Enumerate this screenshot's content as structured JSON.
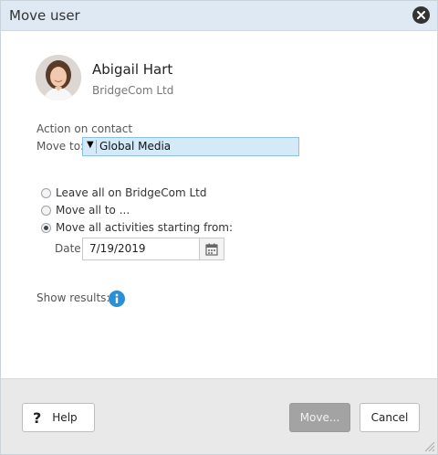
{
  "dialog": {
    "title": "Move user"
  },
  "user": {
    "name": "Abigail Hart",
    "company": "BridgeCom Ltd"
  },
  "action": {
    "section_label": "Action on contact",
    "move_to_label": "Move to:",
    "move_to_value": "Global Media"
  },
  "options": [
    {
      "label": "Leave all on BridgeCom Ltd",
      "checked": false
    },
    {
      "label": "Move all to ...",
      "checked": false
    },
    {
      "label": "Move all activities starting from:",
      "checked": true
    }
  ],
  "date": {
    "label": "Date:",
    "value": "7/19/2019"
  },
  "show_results": {
    "label": "Show results:"
  },
  "footer": {
    "help_label": "Help",
    "move_label": "Move...",
    "cancel_label": "Cancel"
  },
  "colors": {
    "titlebar": "#dfe9f3",
    "select_bg": "#d4eaf9",
    "info_blue": "#2b8fd6",
    "disabled_button": "#a3a3a3"
  },
  "icons": [
    "close-icon",
    "dropdown-arrow-icon",
    "calendar-icon",
    "info-icon",
    "help-icon",
    "resize-grip-icon"
  ]
}
